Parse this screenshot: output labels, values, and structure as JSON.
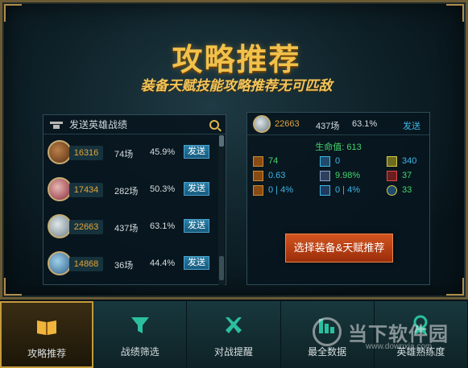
{
  "header": {
    "title": "攻略推荐",
    "subtitle": "装备天赋技能攻略推荐无可匹敌"
  },
  "history_panel": {
    "title": "发送英雄战绩",
    "rows": [
      {
        "id": "16316",
        "games": "74场",
        "rate": "45.9%",
        "send": "发送"
      },
      {
        "id": "17434",
        "games": "282场",
        "rate": "50.3%",
        "send": "发送"
      },
      {
        "id": "22663",
        "games": "437场",
        "rate": "63.1%",
        "send": "发送"
      },
      {
        "id": "14868",
        "games": "36场",
        "rate": "44.4%",
        "send": "发送"
      }
    ]
  },
  "detail_panel": {
    "id": "22663",
    "games": "437场",
    "rate": "63.1%",
    "send": "发送",
    "hp_label": "生命值: 613",
    "stats": [
      {
        "value": "74",
        "color": "#42d66a"
      },
      {
        "value": "0",
        "color": "#3fb5e6"
      },
      {
        "value": "340",
        "color": "#3fb5e6"
      },
      {
        "value": "0.63",
        "color": "#3fb5e6"
      },
      {
        "value": "9.98%",
        "color": "#42d66a"
      },
      {
        "value": "37",
        "color": "#42d66a"
      },
      {
        "value": "0 | 4%",
        "color": "#3fb5e6"
      },
      {
        "value": "0 | 4%",
        "color": "#3fb5e6"
      },
      {
        "value": "33",
        "color": "#42d66a"
      }
    ],
    "cta": "选择装备&天赋推荐"
  },
  "nav": [
    {
      "label": "攻略推荐",
      "icon": "book-icon",
      "active": true
    },
    {
      "label": "战绩筛选",
      "icon": "filter-icon",
      "active": false
    },
    {
      "label": "对战提醒",
      "icon": "crossed-swords-icon",
      "active": false
    },
    {
      "label": "最全数据",
      "icon": "bar-chart-icon",
      "active": false
    },
    {
      "label": "英雄熟练度",
      "icon": "medal-icon",
      "active": false
    }
  ],
  "watermark": {
    "text": "当下软件园",
    "url": "www.downxia.com"
  },
  "colors": {
    "gold": "#f2c14a",
    "id_orange": "#e3a53a",
    "send_blue": "#2a7fa8",
    "cta_orange": "#d2541f",
    "stat_green": "#42d66a",
    "stat_blue": "#3fb5e6"
  }
}
